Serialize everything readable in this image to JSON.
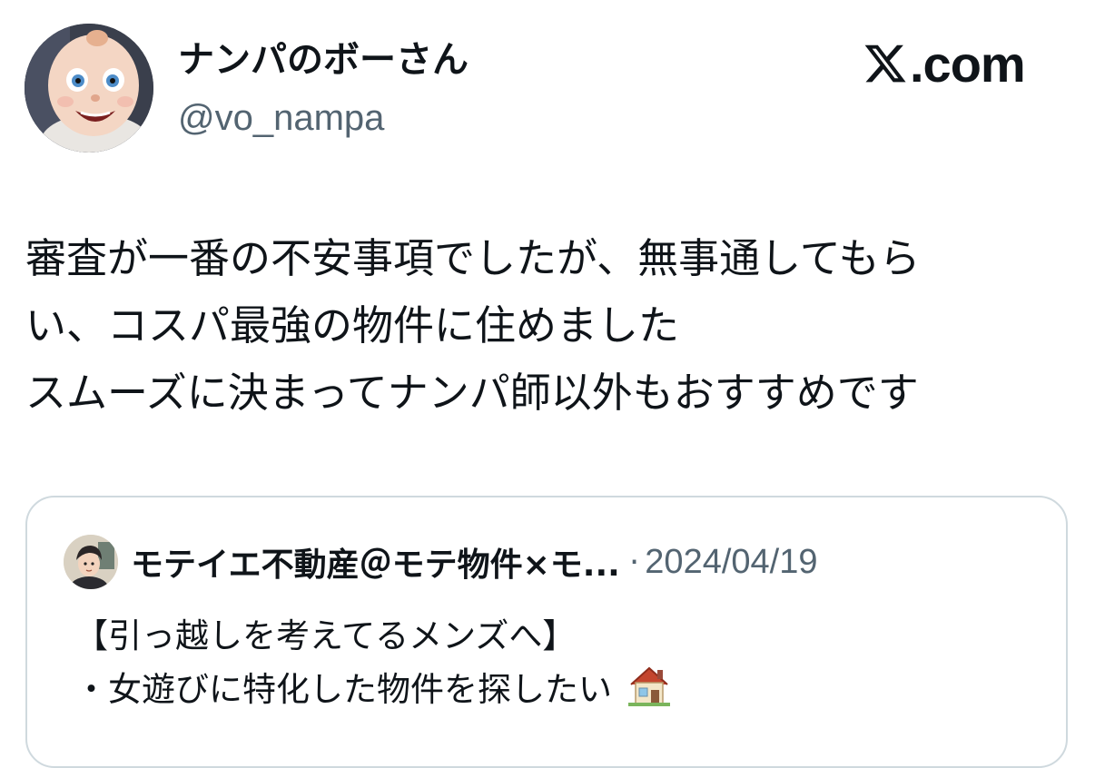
{
  "author": {
    "display_name": "ナンパのボーさん",
    "handle": "@vo_nampa",
    "avatar_icon": "doll-face-avatar-icon"
  },
  "brand": {
    "logo_icon": "x-logo-icon",
    "label": ".com"
  },
  "tweet": {
    "lines": [
      "審査が一番の不安事項でしたが、無事通してもら",
      "い、コスパ最強の物件に住めました",
      "スムーズに決まってナンパ師以外もおすすめです"
    ]
  },
  "quote": {
    "author_name": "モテイエ不動産＠モテ物件×モ...",
    "separator": "·",
    "date": "2024/04/19",
    "avatar_icon": "anime-man-avatar-icon",
    "lines": [
      "【引っ越しを考えてるメンズへ】",
      "・女遊びに特化した物件を探したい"
    ],
    "emoji_icon": "house-icon"
  },
  "colors": {
    "text": "#0f1419",
    "secondary": "#536471",
    "border": "#cfd9de"
  }
}
